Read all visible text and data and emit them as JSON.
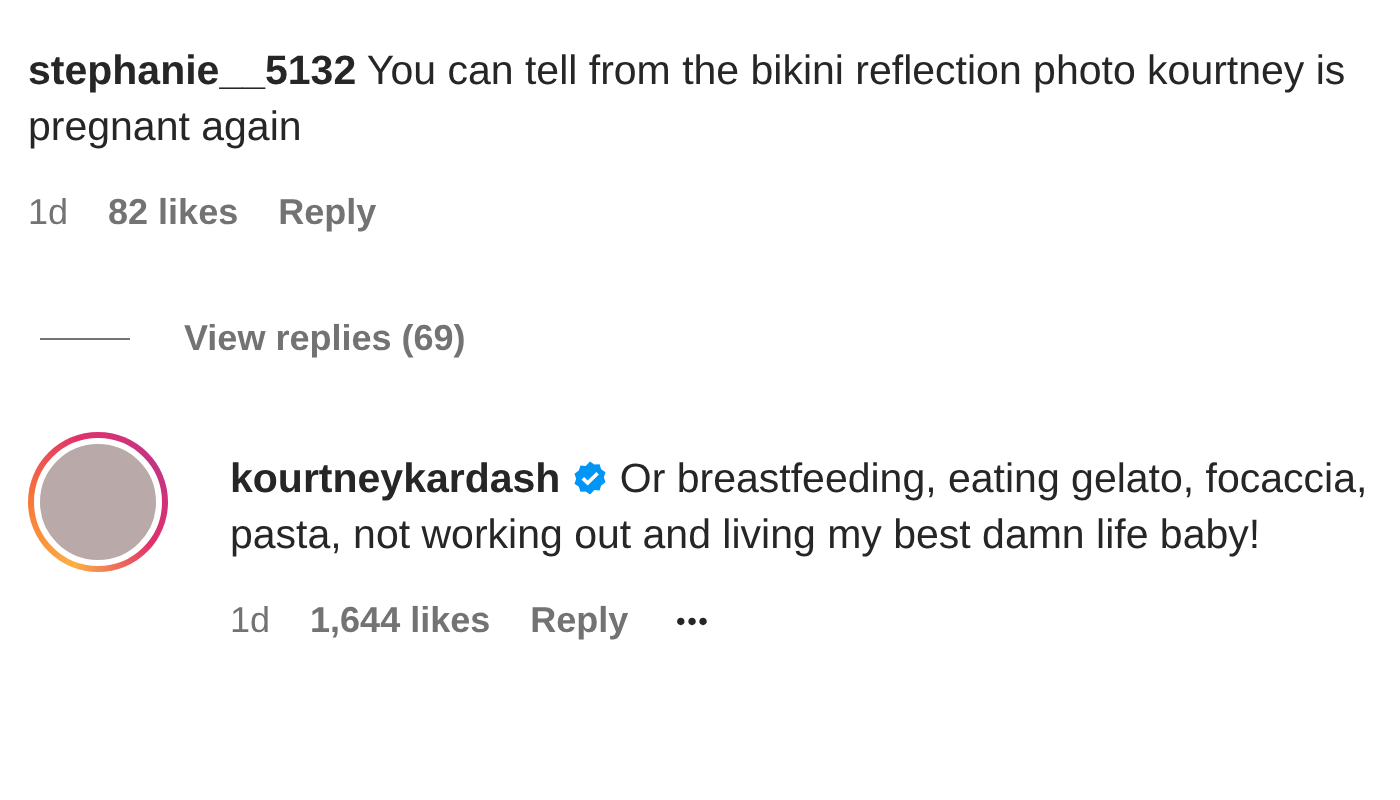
{
  "comment": {
    "username": "stephanie__5132",
    "text": "You can tell from the bikini reflection photo kourtney is pregnant again",
    "time": "1d",
    "likes": "82 likes",
    "reply_label": "Reply"
  },
  "view_replies": "View replies (69)",
  "reply": {
    "username": "kourtneykardash",
    "verified": true,
    "text": "Or breastfeeding, eating gelato, focaccia, pasta, not working out and living my best damn life baby!",
    "time": "1d",
    "likes": "1,644 likes",
    "reply_label": "Reply",
    "more": "•••"
  }
}
